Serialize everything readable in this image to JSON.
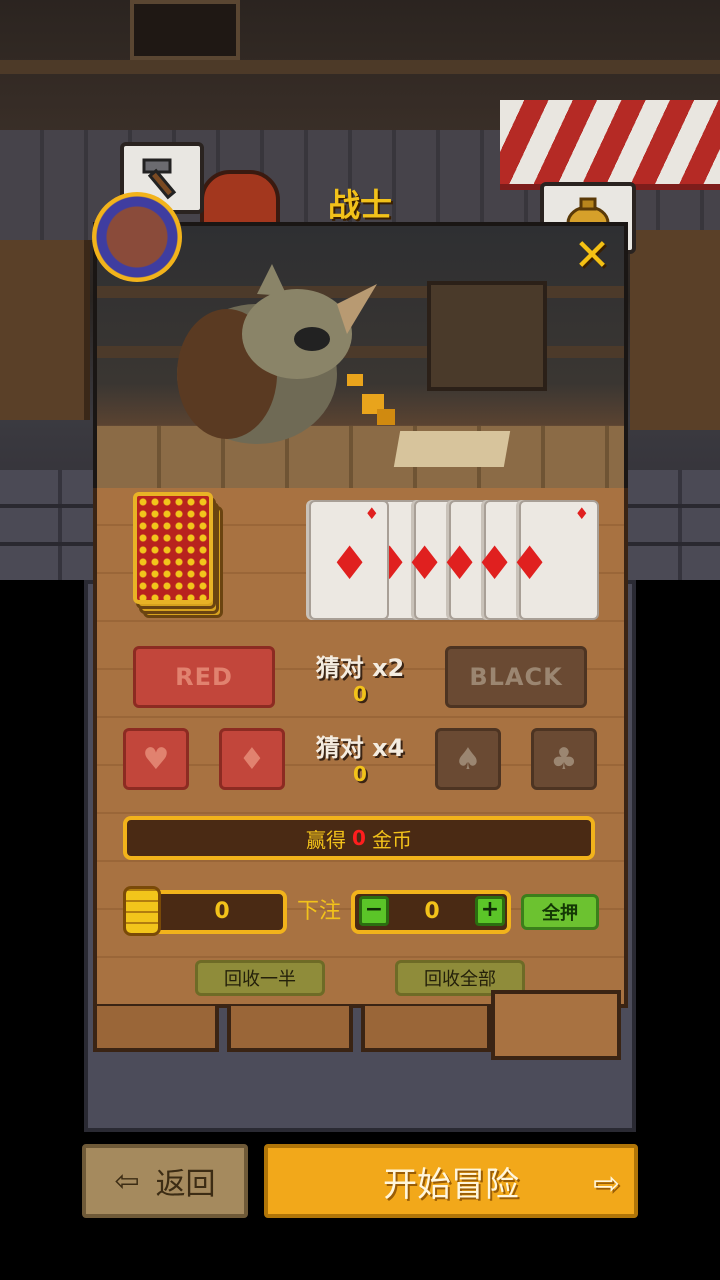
{
  "header": {
    "class_name": "战士"
  },
  "icons": {
    "top_left": "hammer-icon",
    "top_right": "gold-bag-icon",
    "portrait": "class-portrait-icon",
    "close": "close-icon",
    "back": "exit-door-icon",
    "start": "enter-door-icon"
  },
  "game": {
    "deck_label": "deck",
    "cards": [
      {
        "suit": "♦",
        "color": "#e0201f"
      },
      {
        "suit": "♦",
        "color": "#e0201f"
      },
      {
        "suit": "♦",
        "color": "#e0201f"
      },
      {
        "suit": "♦",
        "color": "#e0201f"
      },
      {
        "suit": "♦",
        "color": "#e0201f"
      },
      {
        "suit": "♦",
        "color": "#e0201f"
      },
      {
        "suit": "♦",
        "color": "#e0201f"
      }
    ],
    "red_label": "RED",
    "black_label": "BLACK",
    "color_guess": {
      "label": "猜对 x2",
      "value": "0"
    },
    "suit_guess": {
      "label": "猜对 x4",
      "value": "0"
    },
    "suits": {
      "heart": "♥",
      "diamond": "♦",
      "spade": "♠",
      "club": "♣"
    },
    "win": {
      "prefix": "赢得",
      "amount": "0",
      "suffix": "金币"
    },
    "coins": "0",
    "bet_label": "下注",
    "bet_value": "0",
    "minus": "−",
    "plus": "+",
    "all_in": "全押",
    "collect_half": "回收一半",
    "collect_all": "回收全部"
  },
  "footer": {
    "back_label": "返回",
    "start_label": "开始冒险"
  },
  "colors": {
    "accent_gold": "#f2c21a",
    "red_button": "#c2463b",
    "black_button": "#6a4a33",
    "green_button": "#6cc230",
    "start_button": "#f2a81a"
  }
}
